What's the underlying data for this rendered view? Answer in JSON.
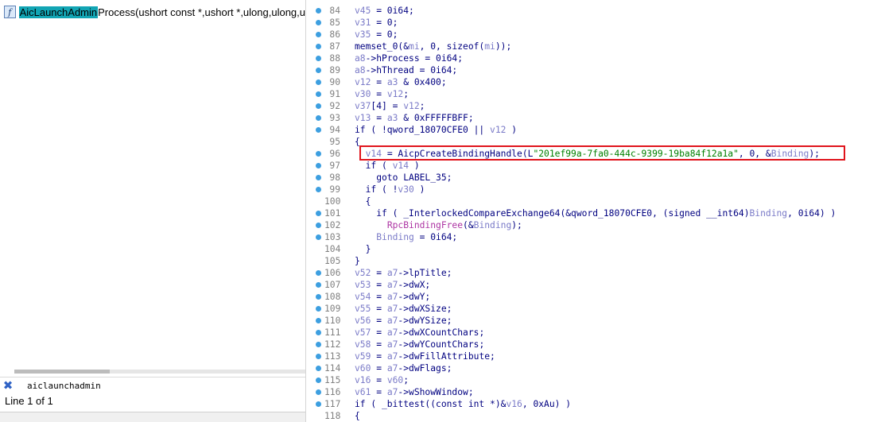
{
  "function_list": {
    "item": {
      "icon": "function-icon",
      "icon_glyph": "f",
      "match": "AicLaunchAdmin",
      "rest": "Process(ushort const *,ushort *,ulong,ulong,u"
    },
    "search": {
      "close_glyph": "✖",
      "value": "aiclaunchadmin"
    },
    "status": "Line 1 of 1"
  },
  "colors": {
    "search_match_bg": "#12a5b4",
    "breakpoint_dot": "#3d9fe0",
    "variable": "#7b7bc8",
    "string": "#008000",
    "call": "#ad34a3",
    "keyword": "#000080",
    "highlight_box": "#e0141c"
  },
  "pseudocode": {
    "highlight_line": 96,
    "lines": [
      {
        "n": "84",
        "dot": true,
        "tokens": [
          {
            "t": "v45",
            "k": "var"
          },
          {
            "t": " = 0i64;",
            "k": "plain"
          }
        ]
      },
      {
        "n": "85",
        "dot": true,
        "tokens": [
          {
            "t": "v31",
            "k": "var"
          },
          {
            "t": " = 0;",
            "k": "plain"
          }
        ]
      },
      {
        "n": "86",
        "dot": true,
        "tokens": [
          {
            "t": "v35",
            "k": "var"
          },
          {
            "t": " = 0;",
            "k": "plain"
          }
        ]
      },
      {
        "n": "87",
        "dot": true,
        "tokens": [
          {
            "t": "memset_0(&",
            "k": "plain"
          },
          {
            "t": "mi",
            "k": "var"
          },
          {
            "t": ", 0, sizeof(",
            "k": "plain"
          },
          {
            "t": "mi",
            "k": "var"
          },
          {
            "t": "));",
            "k": "plain"
          }
        ]
      },
      {
        "n": "88",
        "dot": true,
        "tokens": [
          {
            "t": "a8",
            "k": "var"
          },
          {
            "t": "->hProcess = 0i64;",
            "k": "plain"
          }
        ]
      },
      {
        "n": "89",
        "dot": true,
        "tokens": [
          {
            "t": "a8",
            "k": "var"
          },
          {
            "t": "->hThread = 0i64;",
            "k": "plain"
          }
        ]
      },
      {
        "n": "90",
        "dot": true,
        "tokens": [
          {
            "t": "v12",
            "k": "var"
          },
          {
            "t": " = ",
            "k": "plain"
          },
          {
            "t": "a3",
            "k": "var"
          },
          {
            "t": " & 0x400;",
            "k": "plain"
          }
        ]
      },
      {
        "n": "91",
        "dot": true,
        "tokens": [
          {
            "t": "v30",
            "k": "var"
          },
          {
            "t": " = ",
            "k": "plain"
          },
          {
            "t": "v12",
            "k": "var"
          },
          {
            "t": ";",
            "k": "plain"
          }
        ]
      },
      {
        "n": "92",
        "dot": true,
        "tokens": [
          {
            "t": "v37",
            "k": "var"
          },
          {
            "t": "[4] = ",
            "k": "plain"
          },
          {
            "t": "v12",
            "k": "var"
          },
          {
            "t": ";",
            "k": "plain"
          }
        ]
      },
      {
        "n": "93",
        "dot": true,
        "tokens": [
          {
            "t": "v13",
            "k": "var"
          },
          {
            "t": " = ",
            "k": "plain"
          },
          {
            "t": "a3",
            "k": "var"
          },
          {
            "t": " & 0xFFFFFBFF;",
            "k": "plain"
          }
        ]
      },
      {
        "n": "94",
        "dot": true,
        "tokens": [
          {
            "t": "if ( !qword_18070CFE0 || ",
            "k": "plain"
          },
          {
            "t": "v12",
            "k": "var"
          },
          {
            "t": " )",
            "k": "plain"
          }
        ]
      },
      {
        "n": "95",
        "dot": false,
        "tokens": [
          {
            "t": "{",
            "k": "plain"
          }
        ]
      },
      {
        "n": "96",
        "dot": true,
        "tokens": [
          {
            "t": "  ",
            "k": "plain"
          },
          {
            "t": "v14",
            "k": "var"
          },
          {
            "t": " = AicpCreateBindingHandle(L",
            "k": "plain"
          },
          {
            "t": "\"201ef99a-7fa0-444c-9399-19ba84f12a1a\"",
            "k": "str"
          },
          {
            "t": ", 0, &",
            "k": "plain"
          },
          {
            "t": "Binding",
            "k": "var"
          },
          {
            "t": ");",
            "k": "plain"
          }
        ]
      },
      {
        "n": "97",
        "dot": true,
        "tokens": [
          {
            "t": "  if ( ",
            "k": "plain"
          },
          {
            "t": "v14",
            "k": "var"
          },
          {
            "t": " )",
            "k": "plain"
          }
        ]
      },
      {
        "n": "98",
        "dot": true,
        "tokens": [
          {
            "t": "    goto LABEL_35;",
            "k": "plain"
          }
        ]
      },
      {
        "n": "99",
        "dot": true,
        "tokens": [
          {
            "t": "  if ( !",
            "k": "plain"
          },
          {
            "t": "v30",
            "k": "var"
          },
          {
            "t": " )",
            "k": "plain"
          }
        ]
      },
      {
        "n": "100",
        "dot": false,
        "tokens": [
          {
            "t": "  {",
            "k": "plain"
          }
        ]
      },
      {
        "n": "101",
        "dot": true,
        "tokens": [
          {
            "t": "    if ( _InterlockedCompareExchange64(&qword_18070CFE0, (signed __int64)",
            "k": "plain"
          },
          {
            "t": "Binding",
            "k": "var"
          },
          {
            "t": ", 0i64) )",
            "k": "plain"
          }
        ]
      },
      {
        "n": "102",
        "dot": true,
        "tokens": [
          {
            "t": "      ",
            "k": "plain"
          },
          {
            "t": "RpcBindingFree",
            "k": "fn"
          },
          {
            "t": "(&",
            "k": "plain"
          },
          {
            "t": "Binding",
            "k": "var"
          },
          {
            "t": ");",
            "k": "plain"
          }
        ]
      },
      {
        "n": "103",
        "dot": true,
        "tokens": [
          {
            "t": "    ",
            "k": "plain"
          },
          {
            "t": "Binding",
            "k": "var"
          },
          {
            "t": " = 0i64;",
            "k": "plain"
          }
        ]
      },
      {
        "n": "104",
        "dot": false,
        "tokens": [
          {
            "t": "  }",
            "k": "plain"
          }
        ]
      },
      {
        "n": "105",
        "dot": false,
        "tokens": [
          {
            "t": "}",
            "k": "plain"
          }
        ]
      },
      {
        "n": "106",
        "dot": true,
        "tokens": [
          {
            "t": "v52",
            "k": "var"
          },
          {
            "t": " = ",
            "k": "plain"
          },
          {
            "t": "a7",
            "k": "var"
          },
          {
            "t": "->lpTitle;",
            "k": "plain"
          }
        ]
      },
      {
        "n": "107",
        "dot": true,
        "tokens": [
          {
            "t": "v53",
            "k": "var"
          },
          {
            "t": " = ",
            "k": "plain"
          },
          {
            "t": "a7",
            "k": "var"
          },
          {
            "t": "->dwX;",
            "k": "plain"
          }
        ]
      },
      {
        "n": "108",
        "dot": true,
        "tokens": [
          {
            "t": "v54",
            "k": "var"
          },
          {
            "t": " = ",
            "k": "plain"
          },
          {
            "t": "a7",
            "k": "var"
          },
          {
            "t": "->dwY;",
            "k": "plain"
          }
        ]
      },
      {
        "n": "109",
        "dot": true,
        "tokens": [
          {
            "t": "v55",
            "k": "var"
          },
          {
            "t": " = ",
            "k": "plain"
          },
          {
            "t": "a7",
            "k": "var"
          },
          {
            "t": "->dwXSize;",
            "k": "plain"
          }
        ]
      },
      {
        "n": "110",
        "dot": true,
        "tokens": [
          {
            "t": "v56",
            "k": "var"
          },
          {
            "t": " = ",
            "k": "plain"
          },
          {
            "t": "a7",
            "k": "var"
          },
          {
            "t": "->dwYSize;",
            "k": "plain"
          }
        ]
      },
      {
        "n": "111",
        "dot": true,
        "tokens": [
          {
            "t": "v57",
            "k": "var"
          },
          {
            "t": " = ",
            "k": "plain"
          },
          {
            "t": "a7",
            "k": "var"
          },
          {
            "t": "->dwXCountChars;",
            "k": "plain"
          }
        ]
      },
      {
        "n": "112",
        "dot": true,
        "tokens": [
          {
            "t": "v58",
            "k": "var"
          },
          {
            "t": " = ",
            "k": "plain"
          },
          {
            "t": "a7",
            "k": "var"
          },
          {
            "t": "->dwYCountChars;",
            "k": "plain"
          }
        ]
      },
      {
        "n": "113",
        "dot": true,
        "tokens": [
          {
            "t": "v59",
            "k": "var"
          },
          {
            "t": " = ",
            "k": "plain"
          },
          {
            "t": "a7",
            "k": "var"
          },
          {
            "t": "->dwFillAttribute;",
            "k": "plain"
          }
        ]
      },
      {
        "n": "114",
        "dot": true,
        "tokens": [
          {
            "t": "v60",
            "k": "var"
          },
          {
            "t": " = ",
            "k": "plain"
          },
          {
            "t": "a7",
            "k": "var"
          },
          {
            "t": "->dwFlags;",
            "k": "plain"
          }
        ]
      },
      {
        "n": "115",
        "dot": true,
        "tokens": [
          {
            "t": "v16",
            "k": "var"
          },
          {
            "t": " = ",
            "k": "plain"
          },
          {
            "t": "v60",
            "k": "var"
          },
          {
            "t": ";",
            "k": "plain"
          }
        ]
      },
      {
        "n": "116",
        "dot": true,
        "tokens": [
          {
            "t": "v61",
            "k": "var"
          },
          {
            "t": " = ",
            "k": "plain"
          },
          {
            "t": "a7",
            "k": "var"
          },
          {
            "t": "->wShowWindow;",
            "k": "plain"
          }
        ]
      },
      {
        "n": "117",
        "dot": true,
        "tokens": [
          {
            "t": "if ( _bittest((const int *)&",
            "k": "plain"
          },
          {
            "t": "v16",
            "k": "var"
          },
          {
            "t": ", 0xAu) )",
            "k": "plain"
          }
        ]
      },
      {
        "n": "118",
        "dot": false,
        "tokens": [
          {
            "t": "{",
            "k": "plain"
          }
        ]
      }
    ]
  }
}
